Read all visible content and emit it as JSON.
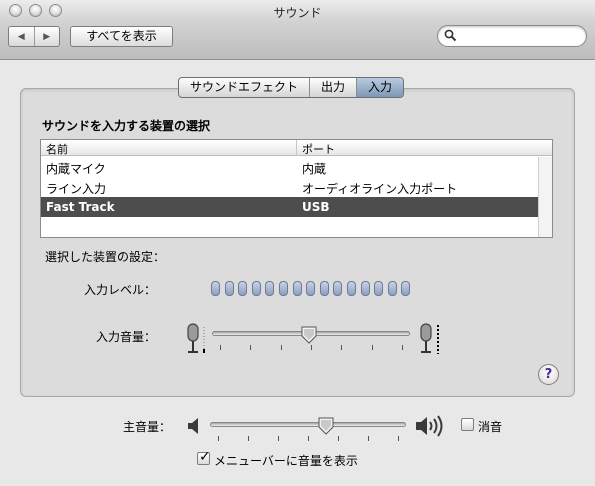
{
  "window": {
    "title": "サウンド"
  },
  "toolbar": {
    "back_label": "◀",
    "forward_label": "▶",
    "show_all_label": "すべてを表示",
    "search_value": "",
    "search_placeholder": ""
  },
  "tabs": [
    {
      "label": "サウンドエフェクト",
      "active": false
    },
    {
      "label": "出力",
      "active": false
    },
    {
      "label": "入力",
      "active": true
    }
  ],
  "input_panel": {
    "section_title": "サウンドを入力する装置の選択",
    "columns": [
      "名前",
      "ポート"
    ],
    "devices": [
      {
        "name": "内蔵マイク",
        "port": "内蔵",
        "selected": false
      },
      {
        "name": "ライン入力",
        "port": "オーディオライン入力ポート",
        "selected": false
      },
      {
        "name": "Fast Track",
        "port": "USB",
        "selected": true
      }
    ],
    "selected_settings_label": "選択した装置の設定：",
    "input_level_label": "入力レベル：",
    "input_level_leds": 15,
    "input_level_lit": 0,
    "input_volume_label": "入力音量：",
    "input_volume_fraction": 0.49,
    "help_label": "?"
  },
  "master": {
    "volume_label": "主音量：",
    "volume_fraction": 0.6,
    "mute_label": "消音",
    "mute_checked": false,
    "menubar_label": "メニューバーに音量を表示",
    "menubar_checked": true
  },
  "colors": {
    "selection_row": "#4d4d4d",
    "active_tab": "#9fb3cc",
    "led": "#a9b6d3",
    "help_glyph": "#4b2a8f"
  }
}
